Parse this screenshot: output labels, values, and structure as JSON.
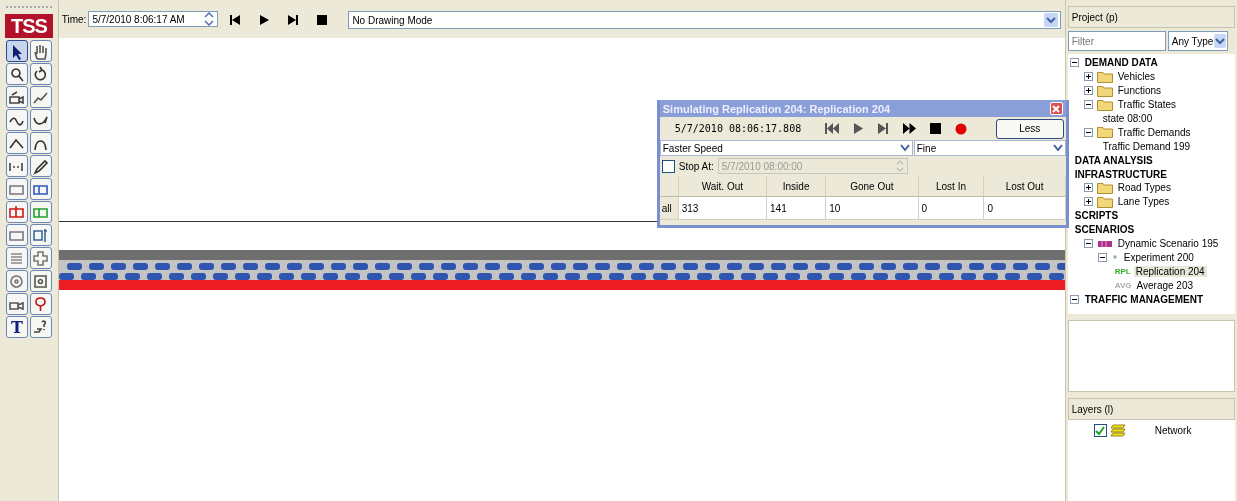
{
  "logo": "TSS",
  "toolbar": [
    {
      "selected": true
    },
    {
      "selected": false
    },
    {
      "selected": false
    },
    {
      "selected": false
    },
    {
      "selected": false
    },
    {
      "selected": false
    },
    {
      "selected": false
    },
    {
      "selected": false
    },
    {
      "selected": false
    },
    {
      "selected": false
    },
    {
      "selected": false
    },
    {
      "selected": false
    },
    {
      "selected": false
    },
    {
      "selected": false
    },
    {
      "selected": false
    },
    {
      "selected": false
    },
    {
      "selected": false
    },
    {
      "selected": false
    },
    {
      "selected": false
    },
    {
      "selected": false
    },
    {
      "selected": false
    },
    {
      "selected": false
    },
    {
      "selected": false
    },
    {
      "selected": false
    },
    {
      "selected": false,
      "glyph": "T"
    },
    {
      "selected": false
    }
  ],
  "time_bar": {
    "label": "Time:",
    "value": "5/7/2010 8:06:17 AM",
    "drawing_mode": "No Drawing Mode"
  },
  "dialog": {
    "title": "Simulating Replication 204: Replication 204",
    "time": "5/7/2010 08:06:17.808",
    "less_button": "Less",
    "speed": "Faster Speed",
    "precision": "Fine",
    "stop_at": {
      "label": "Stop At:",
      "checked": false,
      "value": "5/7/2010 08:00:00"
    },
    "table": {
      "columns": [
        "Wait. Out",
        "Inside",
        "Gone Out",
        "Lost In",
        "Lost Out"
      ],
      "rows": [
        {
          "label": "all",
          "cells": [
            "313",
            "141",
            "10",
            "0",
            "0"
          ]
        }
      ]
    }
  },
  "project": {
    "title": "Project (p)",
    "filter": {
      "placeholder": "Filter"
    },
    "type_filter": "Any Type",
    "tree": [
      {
        "label": "DEMAND DATA",
        "kind": "category",
        "expanded": true,
        "selected": false,
        "children": [
          {
            "label": "Vehicles",
            "kind": "folder",
            "expanded": false,
            "selected": false
          },
          {
            "label": "Functions",
            "kind": "folder",
            "expanded": false,
            "selected": false
          },
          {
            "label": "Traffic States",
            "kind": "folder",
            "expanded": true,
            "selected": false,
            "children": [
              {
                "label": "state  08:00",
                "kind": "item",
                "selected": false
              }
            ]
          },
          {
            "label": "Traffic Demands",
            "kind": "folder",
            "expanded": true,
            "selected": false,
            "children": [
              {
                "label": "Traffic Demand 199",
                "kind": "item",
                "selected": false
              }
            ]
          }
        ]
      },
      {
        "label": "DATA ANALYSIS",
        "kind": "category",
        "selected": false
      },
      {
        "label": "INFRASTRUCTURE",
        "kind": "category",
        "selected": false,
        "children": [
          {
            "label": "Road Types",
            "kind": "folder",
            "expanded": false,
            "selected": false
          },
          {
            "label": "Lane Types",
            "kind": "folder",
            "expanded": false,
            "selected": false
          }
        ]
      },
      {
        "label": "SCRIPTS",
        "kind": "category",
        "selected": false
      },
      {
        "label": "SCENARIOS",
        "kind": "category",
        "selected": false,
        "children": [
          {
            "label": "Dynamic Scenario 195",
            "kind": "scenario",
            "expanded": true,
            "selected": false,
            "children": [
              {
                "label": "Experiment 200",
                "kind": "experiment",
                "expanded": true,
                "selected": false,
                "children": [
                  {
                    "label": "Replication 204",
                    "kind": "replication",
                    "badge": "RPL",
                    "selected": true
                  },
                  {
                    "label": "Average 203",
                    "kind": "average",
                    "badge": "AVG",
                    "selected": false
                  }
                ]
              }
            ]
          }
        ]
      },
      {
        "label": "TRAFFIC MANAGEMENT",
        "kind": "category",
        "expanded": true,
        "selected": false
      }
    ]
  },
  "layers": {
    "title": "Layers (l)",
    "items": [
      {
        "label": "Network",
        "checked": true
      }
    ]
  }
}
